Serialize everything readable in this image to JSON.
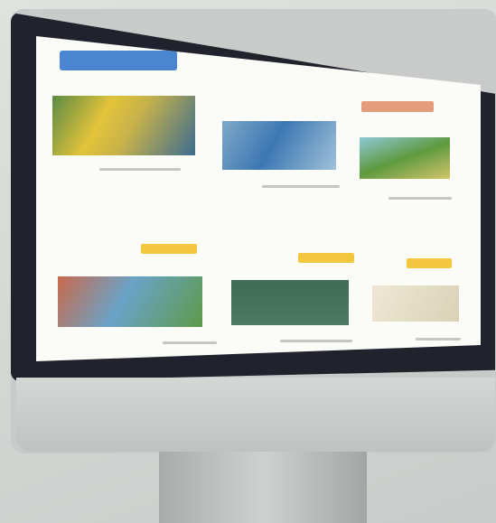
{
  "scene": {
    "description_free": true
  },
  "page": {
    "button_label": "",
    "header_title": ""
  },
  "products": [
    {
      "id": 1
    },
    {
      "id": 2
    },
    {
      "id": 3
    },
    {
      "id": 4
    },
    {
      "id": 5
    },
    {
      "id": 6
    }
  ]
}
